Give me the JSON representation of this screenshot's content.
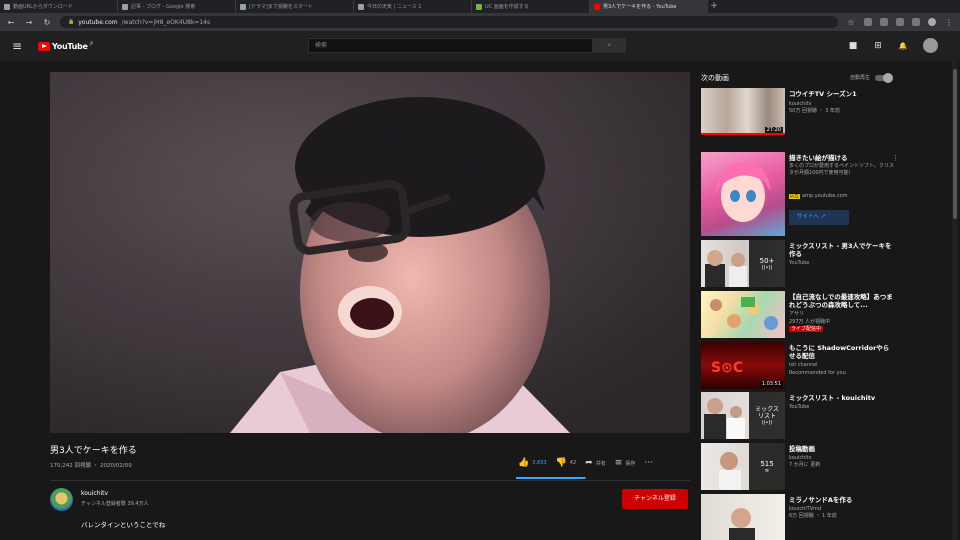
{
  "browser": {
    "tabs": [
      {
        "label": "動画URLからダウンロード",
        "color": "#9aa0a6",
        "active": false
      },
      {
        "label": "記事 - ブログ - Google 検索",
        "color": "#9aa0a6",
        "active": false
      },
      {
        "label": "[ドラマ]まで視聴をスタート",
        "color": "#9aa0a6",
        "active": false
      },
      {
        "label": "今日の天気 | ニュース 1",
        "color": "#9aa0a6",
        "active": false
      },
      {
        "label": "UC 画面を作成する",
        "color": "#7cb342",
        "active": false
      },
      {
        "label": "男3人でケーキを作る - YouTube",
        "color": "#ff0000",
        "active": true
      }
    ],
    "new_tab": "+",
    "back": "←",
    "forward": "→",
    "reload": "↻",
    "lock": "🔒",
    "url_domain": "youtube.com",
    "url_path": "/watch?v=jH8_eOK4U8k=14s",
    "star": "☆",
    "menu": "⋮"
  },
  "youtube_header": {
    "menu": "≡",
    "logo_text": "YouTube",
    "logo_region": "JP",
    "search_placeholder": "検索",
    "search_button": "⌕",
    "camera": "■",
    "apps": "⊞",
    "bell": "🔔"
  },
  "video": {
    "title": "男3人でケーキを作る",
    "meta": "170,242 回視聴 ・ 2020/02/09",
    "likes": "3,833",
    "dislikes": "42",
    "share": "共有",
    "save": "保存",
    "more": "⋯",
    "like_ratio": 0.99
  },
  "channel": {
    "name": "kouichitv",
    "subscribers": "チャンネル登録者数 39.4万人",
    "subscribe_button": "チャンネル登録",
    "description": "バレンタインということでね"
  },
  "sidebar": {
    "title": "次の動画",
    "autoplay_label": "自動再生",
    "items": [
      {
        "title": "コウイチTV シーズン1",
        "sub1": "kouichitv",
        "sub2": "50万 回視聴 ・ 3 年前",
        "duration": "27:20",
        "watched": 1.0
      },
      {
        "title": "描きたい絵が描ける",
        "sub1": "多くのプロが愛用するペイントソフト。クリスタが月額100円で使用可能！",
        "ad_badge": "広告",
        "sub2": "amp.youtube.com",
        "cta": "サイトへ"
      },
      {
        "title": "ミックスリスト - 男3人でケーキを作る",
        "sub1": "YouTube",
        "playlist_count": "50+"
      },
      {
        "title": "【自己流なしでの最速攻略】あつまれどうぶつの森攻略して...",
        "sub1": "アサリ",
        "sub2": "297万 人が視聴中",
        "badge": "ライブ配信中"
      },
      {
        "title": "もこうに ShadowCorridorやらせる配信",
        "sub1": "ish channel",
        "sub2": "Recommended for you",
        "duration": "1:03:51"
      },
      {
        "title": "ミックスリスト - kouichitv",
        "sub1": "YouTube",
        "mix_label": "ミックス リスト"
      },
      {
        "title": "投稿動画",
        "sub1": "kouichitv",
        "sub2": "7 か月に 更新",
        "playlist_count": "515"
      },
      {
        "title": "ミラノサンドAを作る",
        "sub1": "kouichiTVmd",
        "sub2": "6万 回視聴 ・ 1 年前"
      }
    ]
  }
}
